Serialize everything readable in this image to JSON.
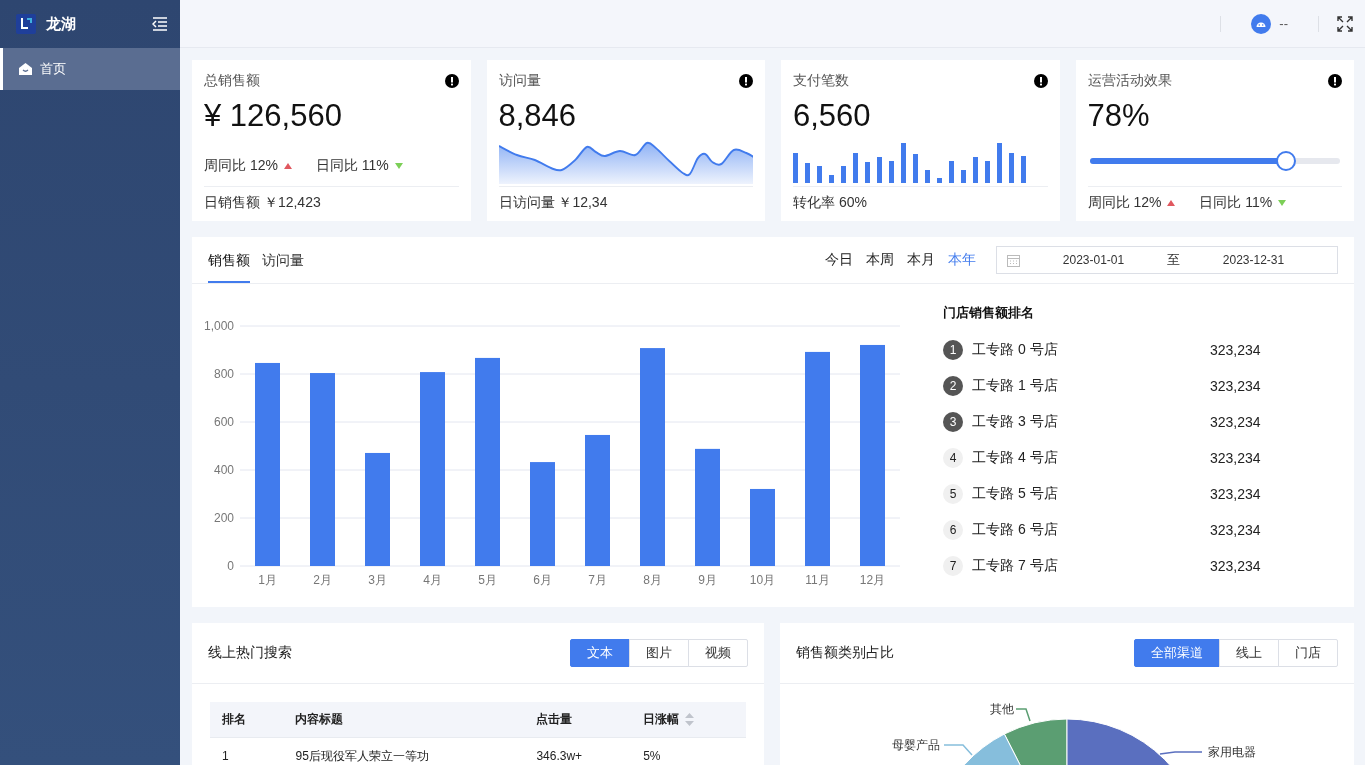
{
  "sidebar": {
    "brand": "龙湖",
    "menu": [
      {
        "label": "首页",
        "selected": true
      }
    ]
  },
  "header": {
    "user": "--"
  },
  "stats": [
    {
      "kind": "trend",
      "title": "总销售额",
      "value": "¥ 126,560",
      "trends": [
        {
          "label": "周同比 12%",
          "rising": true
        },
        {
          "label": "日同比 11%",
          "rising": false
        }
      ],
      "footer": {
        "kind": "text",
        "text": "日销售额 ￥12,423"
      }
    },
    {
      "kind": "area",
      "title": "访问量",
      "value": "8,846",
      "footer": {
        "kind": "text",
        "text": "日访问量 ￥12,34"
      }
    },
    {
      "kind": "bars",
      "title": "支付笔数",
      "value": "6,560",
      "footer": {
        "kind": "text",
        "text": "转化率 60%"
      }
    },
    {
      "kind": "progress",
      "title": "运营活动效果",
      "value": "78%",
      "level": 0.78,
      "footer": {
        "kind": "trends",
        "trends": [
          {
            "label": "周同比 12%",
            "rising": true
          },
          {
            "label": "日同比 11%",
            "rising": false
          }
        ]
      }
    }
  ],
  "sales": {
    "tabs": [
      {
        "label": "销售额",
        "selected": true
      },
      {
        "label": "访问量",
        "selected": false
      }
    ],
    "ranges": [
      {
        "label": "今日",
        "selected": false
      },
      {
        "label": "本周",
        "selected": false
      },
      {
        "label": "本月",
        "selected": false
      },
      {
        "label": "本年",
        "selected": true
      }
    ],
    "date_range": {
      "start": "2023-01-01",
      "separator": "至",
      "end": "2023-12-31"
    },
    "chart_data": {
      "type": "bar",
      "categories": [
        "1月",
        "2月",
        "3月",
        "4月",
        "5月",
        "6月",
        "7月",
        "8月",
        "9月",
        "10月",
        "11月",
        "12月"
      ],
      "grid": true,
      "series": [
        {
          "color": "#417bed",
          "values": [
            846,
            804,
            471,
            808,
            867,
            433,
            546,
            908,
            488,
            321,
            892,
            921
          ]
        }
      ],
      "ylim": [
        0,
        1000
      ],
      "yticks": [
        0,
        200,
        400,
        600,
        800,
        {
          "value": 1000,
          "label": "1,000"
        }
      ]
    },
    "ranking": {
      "title": "门店销售额排名",
      "items": [
        {
          "rank": "1",
          "name": "工专路 0 号店",
          "value": "323,234",
          "highlighted": true
        },
        {
          "rank": "2",
          "name": "工专路 1 号店",
          "value": "323,234",
          "highlighted": true
        },
        {
          "rank": "3",
          "name": "工专路 3 号店",
          "value": "323,234",
          "highlighted": true
        },
        {
          "rank": "4",
          "name": "工专路 4 号店",
          "value": "323,234",
          "highlighted": false
        },
        {
          "rank": "5",
          "name": "工专路 5 号店",
          "value": "323,234",
          "highlighted": false
        },
        {
          "rank": "6",
          "name": "工专路 6 号店",
          "value": "323,234",
          "highlighted": false
        },
        {
          "rank": "7",
          "name": "工专路 7 号店",
          "value": "323,234",
          "highlighted": false
        }
      ]
    }
  },
  "hot_search": {
    "title": "线上热门搜索",
    "segments": [
      {
        "label": "文本",
        "selected": true
      },
      {
        "label": "图片",
        "selected": false
      },
      {
        "label": "视频",
        "selected": false
      }
    ],
    "table": {
      "columns": [
        {
          "label": "排名",
          "sortable": false
        },
        {
          "label": "内容标题",
          "sortable": false
        },
        {
          "label": "点击量",
          "sortable": false
        },
        {
          "label": "日涨幅",
          "sortable": true
        }
      ],
      "rows": [
        {
          "cells": [
            "1",
            "95后现役军人荣立一等功",
            "346.3w+",
            "5%"
          ]
        }
      ]
    }
  },
  "category_share": {
    "title": "销售额类别占比",
    "segments": [
      {
        "label": "全部渠道",
        "selected": true
      },
      {
        "label": "线上",
        "selected": false
      },
      {
        "label": "门店",
        "selected": false
      }
    ],
    "pie_labels": [
      {
        "label": "其他",
        "color": "#5b9e72"
      },
      {
        "label": "母婴产品",
        "color": "#86bedc"
      },
      {
        "label": "家用电器",
        "color": "#5a6fbf"
      }
    ]
  }
}
